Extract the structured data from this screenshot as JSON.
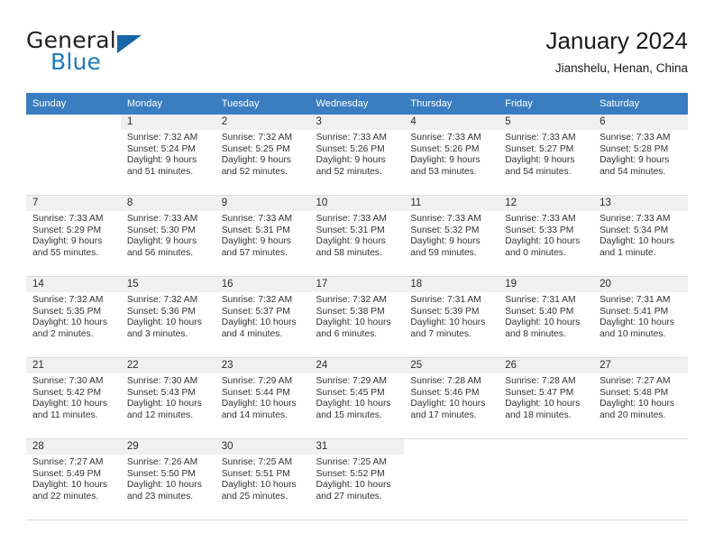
{
  "brand": {
    "name_part1": "General",
    "name_part2": "Blue",
    "triangle_icon": "triangle-icon",
    "color_dark": "#231f20",
    "color_blue": "#1f7ac1",
    "color_triangle": "#1565a8"
  },
  "header": {
    "title": "January 2024",
    "location": "Jianshelu, Henan, China"
  },
  "theme": {
    "header_row_bg": "#3a7dc0",
    "header_row_text": "#ffffff",
    "daynum_bg": "#f0f0f0",
    "grid_line": "#dcdcdc"
  },
  "weekdays": [
    "Sunday",
    "Monday",
    "Tuesday",
    "Wednesday",
    "Thursday",
    "Friday",
    "Saturday"
  ],
  "weeks": [
    [
      {
        "day": "",
        "lines": []
      },
      {
        "day": "1",
        "lines": [
          "Sunrise: 7:32 AM",
          "Sunset: 5:24 PM",
          "Daylight: 9 hours",
          "and 51 minutes."
        ]
      },
      {
        "day": "2",
        "lines": [
          "Sunrise: 7:32 AM",
          "Sunset: 5:25 PM",
          "Daylight: 9 hours",
          "and 52 minutes."
        ]
      },
      {
        "day": "3",
        "lines": [
          "Sunrise: 7:33 AM",
          "Sunset: 5:26 PM",
          "Daylight: 9 hours",
          "and 52 minutes."
        ]
      },
      {
        "day": "4",
        "lines": [
          "Sunrise: 7:33 AM",
          "Sunset: 5:26 PM",
          "Daylight: 9 hours",
          "and 53 minutes."
        ]
      },
      {
        "day": "5",
        "lines": [
          "Sunrise: 7:33 AM",
          "Sunset: 5:27 PM",
          "Daylight: 9 hours",
          "and 54 minutes."
        ]
      },
      {
        "day": "6",
        "lines": [
          "Sunrise: 7:33 AM",
          "Sunset: 5:28 PM",
          "Daylight: 9 hours",
          "and 54 minutes."
        ]
      }
    ],
    [
      {
        "day": "7",
        "lines": [
          "Sunrise: 7:33 AM",
          "Sunset: 5:29 PM",
          "Daylight: 9 hours",
          "and 55 minutes."
        ]
      },
      {
        "day": "8",
        "lines": [
          "Sunrise: 7:33 AM",
          "Sunset: 5:30 PM",
          "Daylight: 9 hours",
          "and 56 minutes."
        ]
      },
      {
        "day": "9",
        "lines": [
          "Sunrise: 7:33 AM",
          "Sunset: 5:31 PM",
          "Daylight: 9 hours",
          "and 57 minutes."
        ]
      },
      {
        "day": "10",
        "lines": [
          "Sunrise: 7:33 AM",
          "Sunset: 5:31 PM",
          "Daylight: 9 hours",
          "and 58 minutes."
        ]
      },
      {
        "day": "11",
        "lines": [
          "Sunrise: 7:33 AM",
          "Sunset: 5:32 PM",
          "Daylight: 9 hours",
          "and 59 minutes."
        ]
      },
      {
        "day": "12",
        "lines": [
          "Sunrise: 7:33 AM",
          "Sunset: 5:33 PM",
          "Daylight: 10 hours",
          "and 0 minutes."
        ]
      },
      {
        "day": "13",
        "lines": [
          "Sunrise: 7:33 AM",
          "Sunset: 5:34 PM",
          "Daylight: 10 hours",
          "and 1 minute."
        ]
      }
    ],
    [
      {
        "day": "14",
        "lines": [
          "Sunrise: 7:32 AM",
          "Sunset: 5:35 PM",
          "Daylight: 10 hours",
          "and 2 minutes."
        ]
      },
      {
        "day": "15",
        "lines": [
          "Sunrise: 7:32 AM",
          "Sunset: 5:36 PM",
          "Daylight: 10 hours",
          "and 3 minutes."
        ]
      },
      {
        "day": "16",
        "lines": [
          "Sunrise: 7:32 AM",
          "Sunset: 5:37 PM",
          "Daylight: 10 hours",
          "and 4 minutes."
        ]
      },
      {
        "day": "17",
        "lines": [
          "Sunrise: 7:32 AM",
          "Sunset: 5:38 PM",
          "Daylight: 10 hours",
          "and 6 minutes."
        ]
      },
      {
        "day": "18",
        "lines": [
          "Sunrise: 7:31 AM",
          "Sunset: 5:39 PM",
          "Daylight: 10 hours",
          "and 7 minutes."
        ]
      },
      {
        "day": "19",
        "lines": [
          "Sunrise: 7:31 AM",
          "Sunset: 5:40 PM",
          "Daylight: 10 hours",
          "and 8 minutes."
        ]
      },
      {
        "day": "20",
        "lines": [
          "Sunrise: 7:31 AM",
          "Sunset: 5:41 PM",
          "Daylight: 10 hours",
          "and 10 minutes."
        ]
      }
    ],
    [
      {
        "day": "21",
        "lines": [
          "Sunrise: 7:30 AM",
          "Sunset: 5:42 PM",
          "Daylight: 10 hours",
          "and 11 minutes."
        ]
      },
      {
        "day": "22",
        "lines": [
          "Sunrise: 7:30 AM",
          "Sunset: 5:43 PM",
          "Daylight: 10 hours",
          "and 12 minutes."
        ]
      },
      {
        "day": "23",
        "lines": [
          "Sunrise: 7:29 AM",
          "Sunset: 5:44 PM",
          "Daylight: 10 hours",
          "and 14 minutes."
        ]
      },
      {
        "day": "24",
        "lines": [
          "Sunrise: 7:29 AM",
          "Sunset: 5:45 PM",
          "Daylight: 10 hours",
          "and 15 minutes."
        ]
      },
      {
        "day": "25",
        "lines": [
          "Sunrise: 7:28 AM",
          "Sunset: 5:46 PM",
          "Daylight: 10 hours",
          "and 17 minutes."
        ]
      },
      {
        "day": "26",
        "lines": [
          "Sunrise: 7:28 AM",
          "Sunset: 5:47 PM",
          "Daylight: 10 hours",
          "and 18 minutes."
        ]
      },
      {
        "day": "27",
        "lines": [
          "Sunrise: 7:27 AM",
          "Sunset: 5:48 PM",
          "Daylight: 10 hours",
          "and 20 minutes."
        ]
      }
    ],
    [
      {
        "day": "28",
        "lines": [
          "Sunrise: 7:27 AM",
          "Sunset: 5:49 PM",
          "Daylight: 10 hours",
          "and 22 minutes."
        ]
      },
      {
        "day": "29",
        "lines": [
          "Sunrise: 7:26 AM",
          "Sunset: 5:50 PM",
          "Daylight: 10 hours",
          "and 23 minutes."
        ]
      },
      {
        "day": "30",
        "lines": [
          "Sunrise: 7:25 AM",
          "Sunset: 5:51 PM",
          "Daylight: 10 hours",
          "and 25 minutes."
        ]
      },
      {
        "day": "31",
        "lines": [
          "Sunrise: 7:25 AM",
          "Sunset: 5:52 PM",
          "Daylight: 10 hours",
          "and 27 minutes."
        ]
      },
      {
        "day": "",
        "lines": []
      },
      {
        "day": "",
        "lines": []
      },
      {
        "day": "",
        "lines": []
      }
    ]
  ]
}
